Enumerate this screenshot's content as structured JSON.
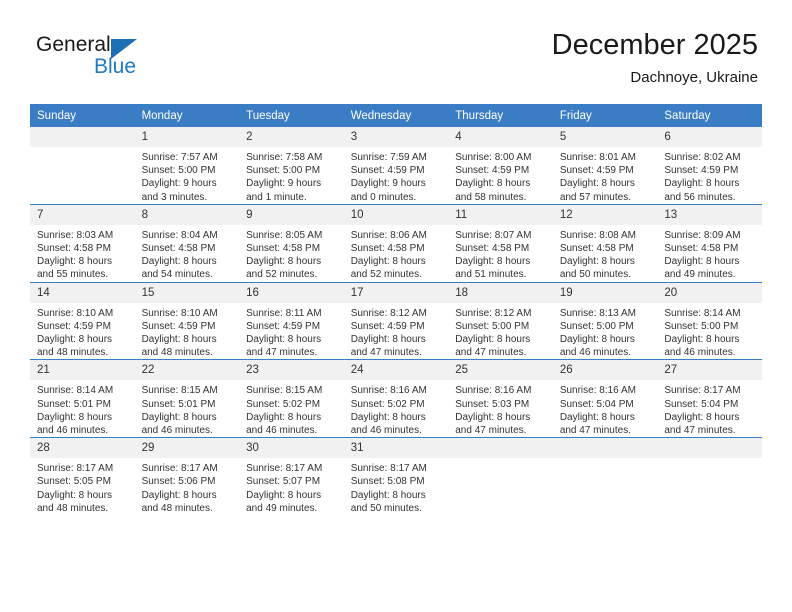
{
  "logo": {
    "word_general": "General",
    "word_blue": "Blue",
    "flag_color": "#1f6fb5"
  },
  "header": {
    "title": "December 2025",
    "subtitle": "Dachnoye, Ukraine",
    "header_bar_color": "#3b7dc4"
  },
  "weekdays": [
    "Sunday",
    "Monday",
    "Tuesday",
    "Wednesday",
    "Thursday",
    "Friday",
    "Saturday"
  ],
  "weeks": [
    [
      {
        "day": "",
        "sunrise": "",
        "sunset": "",
        "daylight_line1": "",
        "daylight_line2": ""
      },
      {
        "day": "1",
        "sunrise": "Sunrise: 7:57 AM",
        "sunset": "Sunset: 5:00 PM",
        "daylight_line1": "Daylight: 9 hours",
        "daylight_line2": "and 3 minutes."
      },
      {
        "day": "2",
        "sunrise": "Sunrise: 7:58 AM",
        "sunset": "Sunset: 5:00 PM",
        "daylight_line1": "Daylight: 9 hours",
        "daylight_line2": "and 1 minute."
      },
      {
        "day": "3",
        "sunrise": "Sunrise: 7:59 AM",
        "sunset": "Sunset: 4:59 PM",
        "daylight_line1": "Daylight: 9 hours",
        "daylight_line2": "and 0 minutes."
      },
      {
        "day": "4",
        "sunrise": "Sunrise: 8:00 AM",
        "sunset": "Sunset: 4:59 PM",
        "daylight_line1": "Daylight: 8 hours",
        "daylight_line2": "and 58 minutes."
      },
      {
        "day": "5",
        "sunrise": "Sunrise: 8:01 AM",
        "sunset": "Sunset: 4:59 PM",
        "daylight_line1": "Daylight: 8 hours",
        "daylight_line2": "and 57 minutes."
      },
      {
        "day": "6",
        "sunrise": "Sunrise: 8:02 AM",
        "sunset": "Sunset: 4:59 PM",
        "daylight_line1": "Daylight: 8 hours",
        "daylight_line2": "and 56 minutes."
      }
    ],
    [
      {
        "day": "7",
        "sunrise": "Sunrise: 8:03 AM",
        "sunset": "Sunset: 4:58 PM",
        "daylight_line1": "Daylight: 8 hours",
        "daylight_line2": "and 55 minutes."
      },
      {
        "day": "8",
        "sunrise": "Sunrise: 8:04 AM",
        "sunset": "Sunset: 4:58 PM",
        "daylight_line1": "Daylight: 8 hours",
        "daylight_line2": "and 54 minutes."
      },
      {
        "day": "9",
        "sunrise": "Sunrise: 8:05 AM",
        "sunset": "Sunset: 4:58 PM",
        "daylight_line1": "Daylight: 8 hours",
        "daylight_line2": "and 52 minutes."
      },
      {
        "day": "10",
        "sunrise": "Sunrise: 8:06 AM",
        "sunset": "Sunset: 4:58 PM",
        "daylight_line1": "Daylight: 8 hours",
        "daylight_line2": "and 52 minutes."
      },
      {
        "day": "11",
        "sunrise": "Sunrise: 8:07 AM",
        "sunset": "Sunset: 4:58 PM",
        "daylight_line1": "Daylight: 8 hours",
        "daylight_line2": "and 51 minutes."
      },
      {
        "day": "12",
        "sunrise": "Sunrise: 8:08 AM",
        "sunset": "Sunset: 4:58 PM",
        "daylight_line1": "Daylight: 8 hours",
        "daylight_line2": "and 50 minutes."
      },
      {
        "day": "13",
        "sunrise": "Sunrise: 8:09 AM",
        "sunset": "Sunset: 4:58 PM",
        "daylight_line1": "Daylight: 8 hours",
        "daylight_line2": "and 49 minutes."
      }
    ],
    [
      {
        "day": "14",
        "sunrise": "Sunrise: 8:10 AM",
        "sunset": "Sunset: 4:59 PM",
        "daylight_line1": "Daylight: 8 hours",
        "daylight_line2": "and 48 minutes."
      },
      {
        "day": "15",
        "sunrise": "Sunrise: 8:10 AM",
        "sunset": "Sunset: 4:59 PM",
        "daylight_line1": "Daylight: 8 hours",
        "daylight_line2": "and 48 minutes."
      },
      {
        "day": "16",
        "sunrise": "Sunrise: 8:11 AM",
        "sunset": "Sunset: 4:59 PM",
        "daylight_line1": "Daylight: 8 hours",
        "daylight_line2": "and 47 minutes."
      },
      {
        "day": "17",
        "sunrise": "Sunrise: 8:12 AM",
        "sunset": "Sunset: 4:59 PM",
        "daylight_line1": "Daylight: 8 hours",
        "daylight_line2": "and 47 minutes."
      },
      {
        "day": "18",
        "sunrise": "Sunrise: 8:12 AM",
        "sunset": "Sunset: 5:00 PM",
        "daylight_line1": "Daylight: 8 hours",
        "daylight_line2": "and 47 minutes."
      },
      {
        "day": "19",
        "sunrise": "Sunrise: 8:13 AM",
        "sunset": "Sunset: 5:00 PM",
        "daylight_line1": "Daylight: 8 hours",
        "daylight_line2": "and 46 minutes."
      },
      {
        "day": "20",
        "sunrise": "Sunrise: 8:14 AM",
        "sunset": "Sunset: 5:00 PM",
        "daylight_line1": "Daylight: 8 hours",
        "daylight_line2": "and 46 minutes."
      }
    ],
    [
      {
        "day": "21",
        "sunrise": "Sunrise: 8:14 AM",
        "sunset": "Sunset: 5:01 PM",
        "daylight_line1": "Daylight: 8 hours",
        "daylight_line2": "and 46 minutes."
      },
      {
        "day": "22",
        "sunrise": "Sunrise: 8:15 AM",
        "sunset": "Sunset: 5:01 PM",
        "daylight_line1": "Daylight: 8 hours",
        "daylight_line2": "and 46 minutes."
      },
      {
        "day": "23",
        "sunrise": "Sunrise: 8:15 AM",
        "sunset": "Sunset: 5:02 PM",
        "daylight_line1": "Daylight: 8 hours",
        "daylight_line2": "and 46 minutes."
      },
      {
        "day": "24",
        "sunrise": "Sunrise: 8:16 AM",
        "sunset": "Sunset: 5:02 PM",
        "daylight_line1": "Daylight: 8 hours",
        "daylight_line2": "and 46 minutes."
      },
      {
        "day": "25",
        "sunrise": "Sunrise: 8:16 AM",
        "sunset": "Sunset: 5:03 PM",
        "daylight_line1": "Daylight: 8 hours",
        "daylight_line2": "and 47 minutes."
      },
      {
        "day": "26",
        "sunrise": "Sunrise: 8:16 AM",
        "sunset": "Sunset: 5:04 PM",
        "daylight_line1": "Daylight: 8 hours",
        "daylight_line2": "and 47 minutes."
      },
      {
        "day": "27",
        "sunrise": "Sunrise: 8:17 AM",
        "sunset": "Sunset: 5:04 PM",
        "daylight_line1": "Daylight: 8 hours",
        "daylight_line2": "and 47 minutes."
      }
    ],
    [
      {
        "day": "28",
        "sunrise": "Sunrise: 8:17 AM",
        "sunset": "Sunset: 5:05 PM",
        "daylight_line1": "Daylight: 8 hours",
        "daylight_line2": "and 48 minutes."
      },
      {
        "day": "29",
        "sunrise": "Sunrise: 8:17 AM",
        "sunset": "Sunset: 5:06 PM",
        "daylight_line1": "Daylight: 8 hours",
        "daylight_line2": "and 48 minutes."
      },
      {
        "day": "30",
        "sunrise": "Sunrise: 8:17 AM",
        "sunset": "Sunset: 5:07 PM",
        "daylight_line1": "Daylight: 8 hours",
        "daylight_line2": "and 49 minutes."
      },
      {
        "day": "31",
        "sunrise": "Sunrise: 8:17 AM",
        "sunset": "Sunset: 5:08 PM",
        "daylight_line1": "Daylight: 8 hours",
        "daylight_line2": "and 50 minutes."
      },
      {
        "day": "",
        "sunrise": "",
        "sunset": "",
        "daylight_line1": "",
        "daylight_line2": ""
      },
      {
        "day": "",
        "sunrise": "",
        "sunset": "",
        "daylight_line1": "",
        "daylight_line2": ""
      },
      {
        "day": "",
        "sunrise": "",
        "sunset": "",
        "daylight_line1": "",
        "daylight_line2": ""
      }
    ]
  ]
}
